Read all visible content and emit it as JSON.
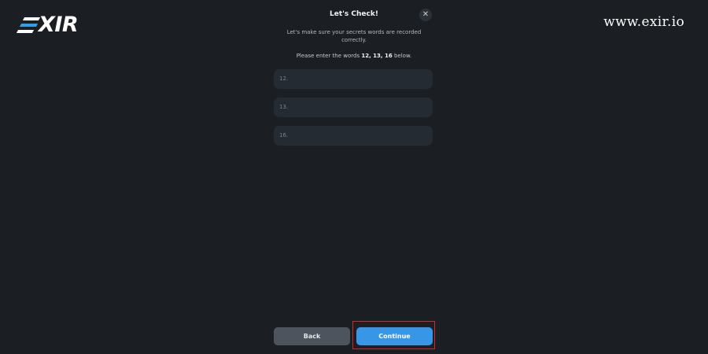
{
  "brand": {
    "logo_text": "XIR",
    "url": "www.exir.io"
  },
  "dialog": {
    "title": "Let's Check!",
    "close_icon": "close-icon",
    "subtitle": "Let's make sure your secrets words are recorded correctly.",
    "instruction_prefix": "Please enter the words ",
    "instruction_words": "12, 13, 16",
    "instruction_suffix": " below.",
    "fields": [
      {
        "number": "12.",
        "value": ""
      },
      {
        "number": "13.",
        "value": ""
      },
      {
        "number": "16.",
        "value": ""
      }
    ]
  },
  "buttons": {
    "back": "Back",
    "continue": "Continue"
  },
  "colors": {
    "background": "#1b1f24",
    "field_bg": "#252b33",
    "primary": "#3797e6",
    "secondary": "#4d545d",
    "highlight": "#d1262b",
    "brand_accent": "#2fa0e8"
  }
}
